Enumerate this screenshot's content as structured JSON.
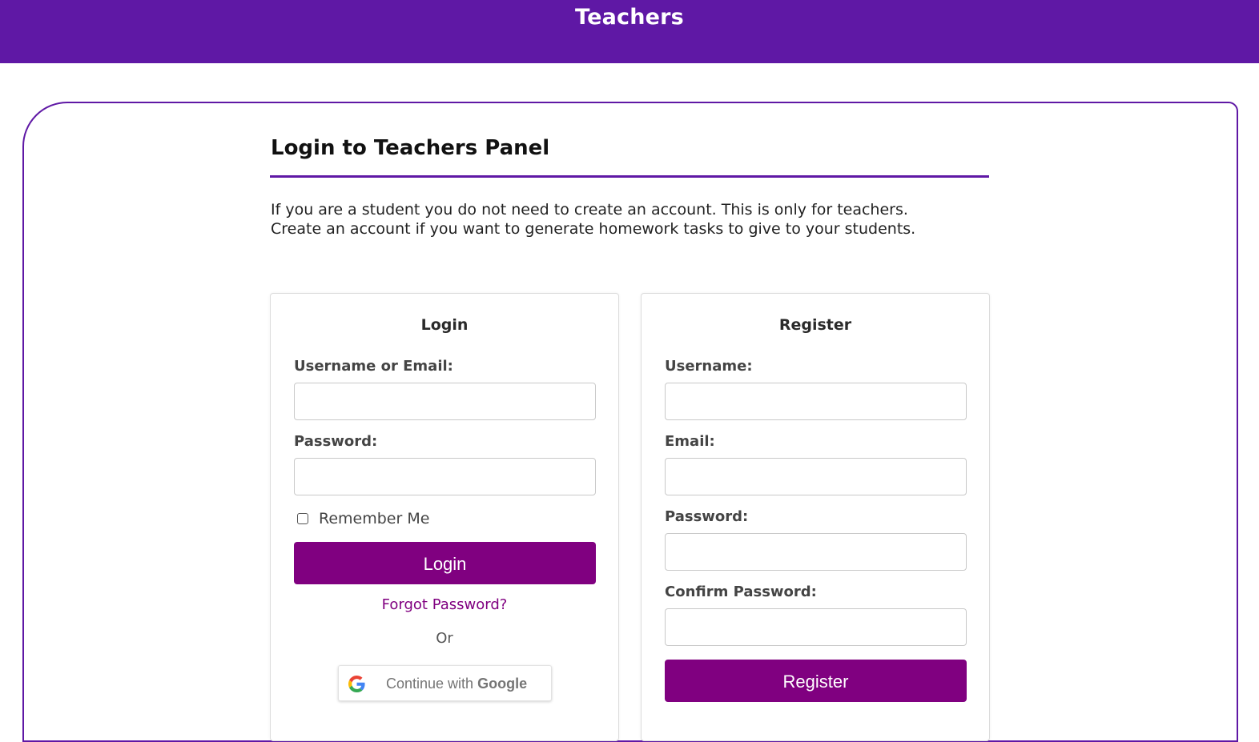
{
  "header": {
    "title": "Teachers"
  },
  "panel": {
    "title": "Login to Teachers Panel",
    "intro_line1": "If you are a student you do not need to create an account. This is only for teachers.",
    "intro_line2": "Create an account if you want to generate homework tasks to give to your students."
  },
  "login": {
    "heading": "Login",
    "username_label": "Username or Email:",
    "password_label": "Password:",
    "remember_label": "Remember Me",
    "submit_label": "Login",
    "forgot_label": "Forgot Password?",
    "or_label": "Or",
    "google_prefix": "Continue with",
    "google_brand": "Google"
  },
  "register": {
    "heading": "Register",
    "username_label": "Username:",
    "email_label": "Email:",
    "password_label": "Password:",
    "confirm_label": "Confirm Password:",
    "submit_label": "Register"
  },
  "colors": {
    "header_bg": "#5f18a5",
    "button_bg": "#800080",
    "link": "#800080"
  },
  "icons": {
    "google": "google-g-icon"
  }
}
